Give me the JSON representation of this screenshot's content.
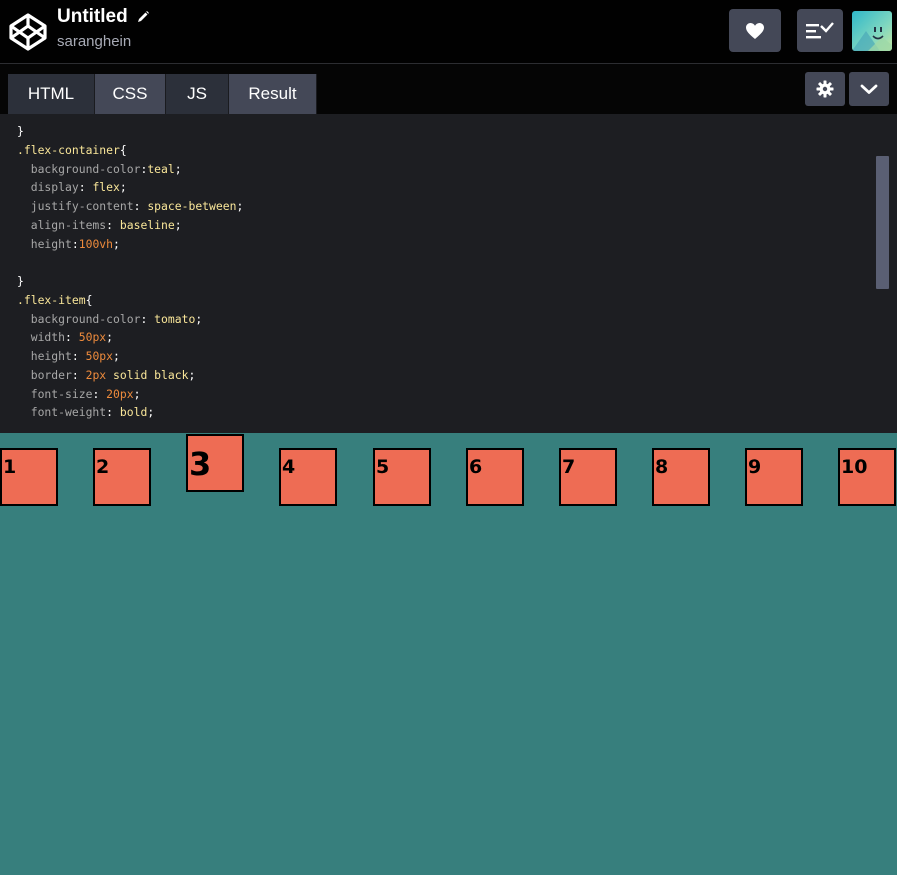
{
  "header": {
    "title": "Untitled",
    "author": "saranghein",
    "icons": {
      "logo": "codepen-logo-icon",
      "edit": "pencil-icon",
      "heart": "heart-icon",
      "views": "view-switcher-icon",
      "avatar": "user-avatar"
    }
  },
  "tabs": [
    {
      "label": "HTML"
    },
    {
      "label": "CSS"
    },
    {
      "label": "JS"
    },
    {
      "label": "Result"
    }
  ],
  "toolbar": {
    "settings_icon": "gear-icon",
    "collapse_icon": "chevron-down-icon"
  },
  "editor": {
    "language": "CSS",
    "lines": [
      [
        [
          "}",
          "pl"
        ]
      ],
      [
        [
          ".flex-container",
          "sel"
        ],
        [
          "{",
          "pl"
        ]
      ],
      [
        [
          "  background-color",
          "prop"
        ],
        [
          ":",
          "pl"
        ],
        [
          "teal",
          "val"
        ],
        [
          ";",
          "pl"
        ]
      ],
      [
        [
          "  display",
          "prop"
        ],
        [
          ": ",
          "pl"
        ],
        [
          "flex",
          "val"
        ],
        [
          ";",
          "pl"
        ]
      ],
      [
        [
          "  justify-content",
          "prop"
        ],
        [
          ": ",
          "pl"
        ],
        [
          "space-between",
          "val"
        ],
        [
          ";",
          "pl"
        ]
      ],
      [
        [
          "  align-items",
          "prop"
        ],
        [
          ": ",
          "pl"
        ],
        [
          "baseline",
          "val"
        ],
        [
          ";",
          "pl"
        ]
      ],
      [
        [
          "  height",
          "prop"
        ],
        [
          ":",
          "pl"
        ],
        [
          "100vh",
          "num"
        ],
        [
          ";",
          "pl"
        ]
      ],
      [],
      [
        [
          "}",
          "pl"
        ]
      ],
      [
        [
          ".flex-item",
          "sel"
        ],
        [
          "{",
          "pl"
        ]
      ],
      [
        [
          "  background-color",
          "prop"
        ],
        [
          ": ",
          "pl"
        ],
        [
          "tomato",
          "val"
        ],
        [
          ";",
          "pl"
        ]
      ],
      [
        [
          "  width",
          "prop"
        ],
        [
          ": ",
          "pl"
        ],
        [
          "50px",
          "num"
        ],
        [
          ";",
          "pl"
        ]
      ],
      [
        [
          "  height",
          "prop"
        ],
        [
          ": ",
          "pl"
        ],
        [
          "50px",
          "num"
        ],
        [
          ";",
          "pl"
        ]
      ],
      [
        [
          "  border",
          "prop"
        ],
        [
          ": ",
          "pl"
        ],
        [
          "2px",
          "num"
        ],
        [
          " ",
          "pl"
        ],
        [
          "solid black",
          "val"
        ],
        [
          ";",
          "pl"
        ]
      ],
      [
        [
          "  font-size",
          "prop"
        ],
        [
          ": ",
          "pl"
        ],
        [
          "20px",
          "num"
        ],
        [
          ";",
          "pl"
        ]
      ],
      [
        [
          "  font-weight",
          "prop"
        ],
        [
          ": ",
          "pl"
        ],
        [
          "bold",
          "val"
        ],
        [
          ";",
          "pl"
        ]
      ]
    ]
  },
  "result": {
    "background_color": "#377f7d",
    "item_color": "#ee6c54",
    "items": [
      "1",
      "2",
      "3",
      "4",
      "5",
      "6",
      "7",
      "8",
      "9",
      "10"
    ]
  }
}
